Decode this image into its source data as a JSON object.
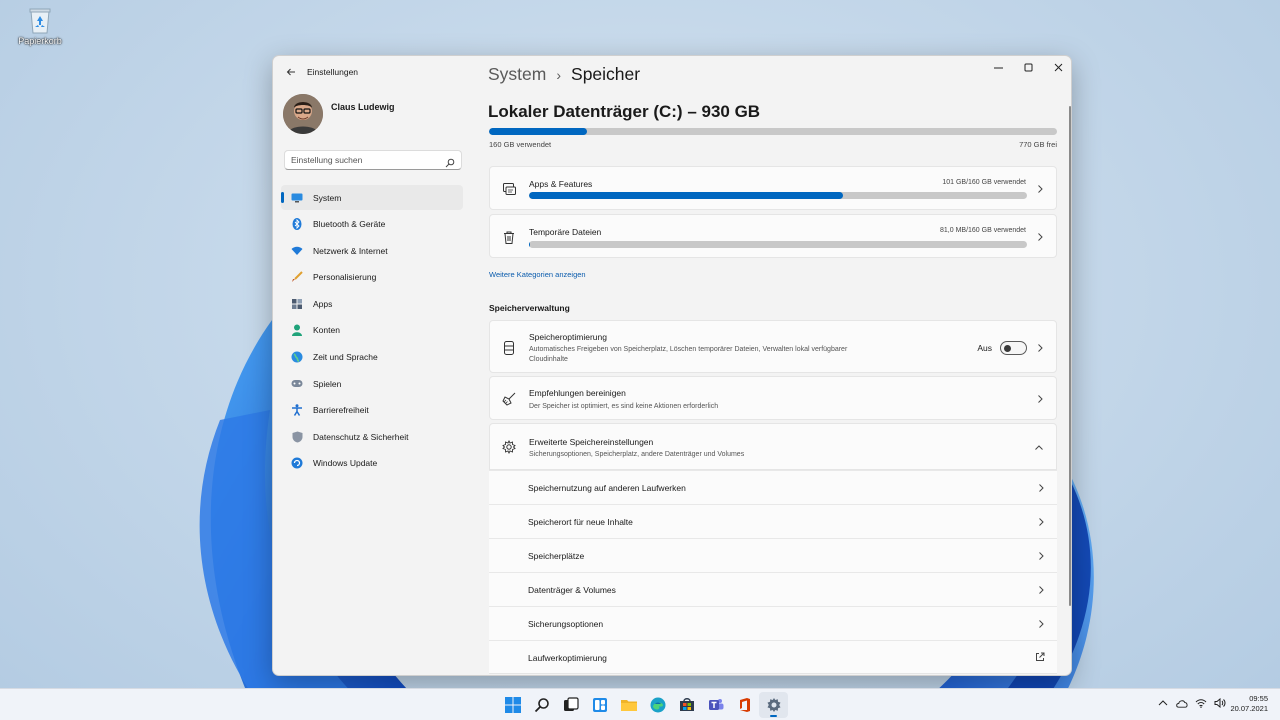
{
  "desktop": {
    "recycle_bin_label": "Papierkorb"
  },
  "window": {
    "app_title": "Einstellungen",
    "profile_name": "Claus Ludewig",
    "search_placeholder": "Einstellung suchen",
    "nav": [
      {
        "label": "System",
        "icon": "system-icon",
        "active": true
      },
      {
        "label": "Bluetooth & Geräte",
        "icon": "bluetooth-icon"
      },
      {
        "label": "Netzwerk & Internet",
        "icon": "wifi-icon"
      },
      {
        "label": "Personalisierung",
        "icon": "brush-icon"
      },
      {
        "label": "Apps",
        "icon": "apps-icon"
      },
      {
        "label": "Konten",
        "icon": "person-icon"
      },
      {
        "label": "Zeit und Sprache",
        "icon": "globe-icon"
      },
      {
        "label": "Spielen",
        "icon": "gamepad-icon"
      },
      {
        "label": "Barrierefreiheit",
        "icon": "accessibility-icon"
      },
      {
        "label": "Datenschutz & Sicherheit",
        "icon": "shield-icon"
      },
      {
        "label": "Windows Update",
        "icon": "update-icon"
      }
    ]
  },
  "content": {
    "breadcrumb_parent": "System",
    "breadcrumb_current": "Speicher",
    "drive_title": "Lokaler Datenträger (C:) – 930 GB",
    "drive_used_label": "160 GB verwendet",
    "drive_free_label": "770 GB frei",
    "drive_used_fraction": 0.172,
    "categories": [
      {
        "title": "Apps & Features",
        "usage": "101 GB/160 GB verwendet",
        "fraction": 0.631
      },
      {
        "title": "Temporäre Dateien",
        "usage": "81,0 MB/160 GB verwendet",
        "fraction": 0.0005
      }
    ],
    "more_categories_link": "Weitere Kategorien anzeigen",
    "section_heading": "Speicherverwaltung",
    "storage_sense": {
      "title": "Speicheroptimierung",
      "desc_line1": "Automatisches Freigeben von Speicherplatz, Löschen temporärer Dateien, Verwalten lokal verfügbarer",
      "desc_line2": "Cloudinhalte",
      "toggle_label": "Aus",
      "toggle_on": false
    },
    "cleanup": {
      "title": "Empfehlungen bereinigen",
      "desc": "Der Speicher ist optimiert, es sind keine Aktionen erforderlich"
    },
    "advanced": {
      "title": "Erweiterte Speichereinstellungen",
      "desc": "Sicherungsoptionen, Speicherplatz, andere Datenträger und Volumes",
      "items": [
        "Speichernutzung auf anderen Laufwerken",
        "Speicherort für neue Inhalte",
        "Speicherplätze",
        "Datenträger & Volumes",
        "Sicherungsoptionen",
        "Laufwerkoptimierung"
      ]
    }
  },
  "taskbar": {
    "clock_time": "09:55",
    "clock_date": "20.07.2021",
    "accent": "#0067c0"
  }
}
